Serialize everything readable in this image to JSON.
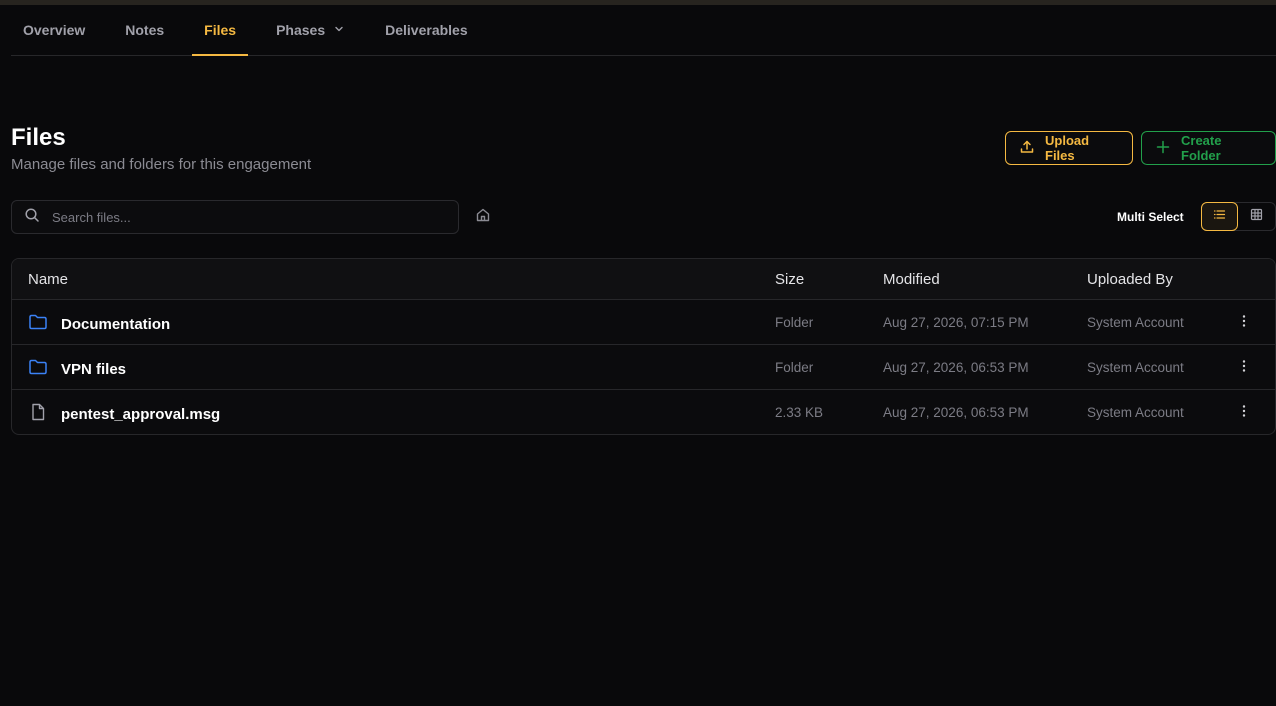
{
  "tabs": [
    {
      "label": "Overview",
      "active": false
    },
    {
      "label": "Notes",
      "active": false
    },
    {
      "label": "Files",
      "active": true
    },
    {
      "label": "Phases",
      "active": false,
      "dropdown": true
    },
    {
      "label": "Deliverables",
      "active": false
    }
  ],
  "header": {
    "title": "Files",
    "subtitle": "Manage files and folders for this engagement"
  },
  "actions": {
    "upload_label": "Upload Files",
    "create_folder_label": "Create Folder"
  },
  "search": {
    "placeholder": "Search files...",
    "value": ""
  },
  "toolbar": {
    "multi_select_label": "Multi Select",
    "view_mode": "list"
  },
  "table": {
    "columns": [
      "Name",
      "Size",
      "Modified",
      "Uploaded By"
    ],
    "rows": [
      {
        "name": "Documentation",
        "type": "folder",
        "size": "Folder",
        "modified": "Aug 27, 2026, 07:15 PM",
        "uploaded_by": "System Account"
      },
      {
        "name": "VPN files",
        "type": "folder",
        "size": "Folder",
        "modified": "Aug 27, 2026, 06:53 PM",
        "uploaded_by": "System Account"
      },
      {
        "name": "pentest_approval.msg",
        "type": "file",
        "size": "2.33 KB",
        "modified": "Aug 27, 2026, 06:53 PM",
        "uploaded_by": "System Account"
      }
    ]
  },
  "colors": {
    "accent": "#f5b942",
    "success": "#22a04b",
    "folder": "#3b82f6",
    "background": "#09090b"
  }
}
